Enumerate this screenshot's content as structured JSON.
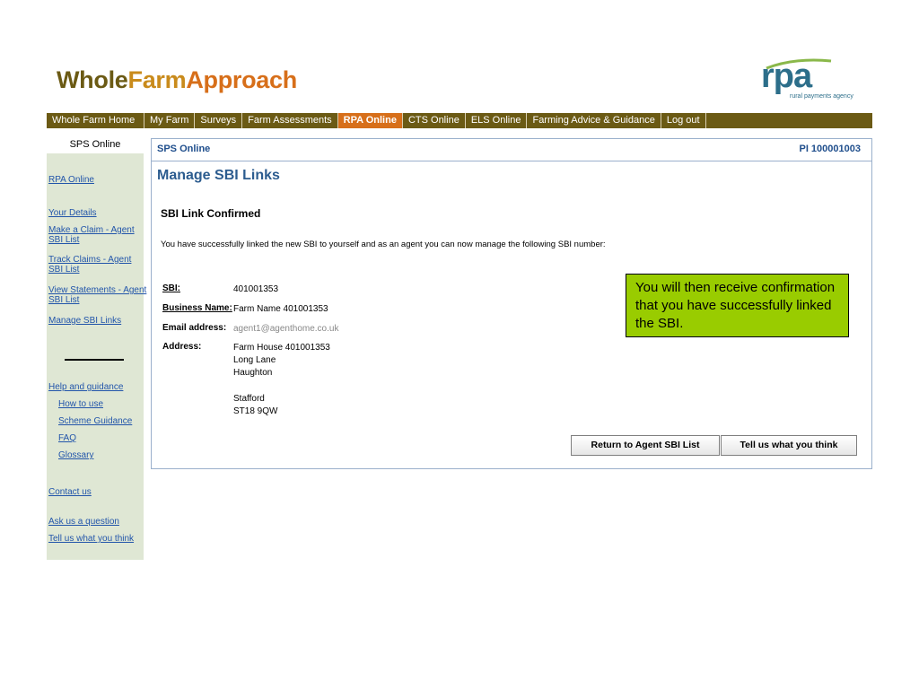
{
  "header": {
    "logo_whole": "Whole",
    "logo_farm": "Farm",
    "logo_approach": "Approach",
    "rpa_logo": "rpa",
    "rpa_tagline": "rural payments agency"
  },
  "nav": {
    "items": [
      "Whole Farm Home",
      "My Farm",
      "Surveys",
      "Farm Assessments",
      "RPA Online",
      "CTS Online",
      "ELS Online",
      "Farming Advice & Guidance",
      "Log out"
    ],
    "active": "RPA Online"
  },
  "sidebar": {
    "tab": "SPS Online",
    "links": {
      "rpa_online": "RPA Online",
      "your_details": "Your Details",
      "make_claim": "Make a Claim - Agent SBI List",
      "track_claims": "Track Claims - Agent SBI List",
      "view_statements": "View Statements - Agent SBI List",
      "manage_sbi": "Manage SBI Links",
      "help": "Help and guidance",
      "how_to_use": "How to use",
      "scheme_guidance": "Scheme Guidance",
      "faq": "FAQ",
      "glossary": "Glossary",
      "contact": "Contact us",
      "ask": "Ask us a question",
      "tell": "Tell us what you think"
    }
  },
  "panel": {
    "header_left": "SPS Online",
    "header_right": "PI 100001003",
    "title": "Manage SBI Links",
    "subtitle": "SBI Link Confirmed",
    "intro": "You have successfully linked the new SBI to yourself and as an agent you can now manage the following SBI number:",
    "details": {
      "sbi_label": "SBI:",
      "sbi_value": "401001353",
      "business_label": "Business Name:",
      "business_value": "Farm Name 401001353",
      "email_label": "Email address:",
      "email_value": "agent1@agenthome.co.uk",
      "address_label": "Address:",
      "address_line1": "Farm House 401001353",
      "address_line2": "Long Lane",
      "address_line3": "Haughton",
      "address_line4": "Stafford",
      "address_line5": "ST18 9QW"
    },
    "buttons": {
      "return": "Return to Agent SBI List",
      "tell": "Tell us what you think"
    }
  },
  "callout": {
    "text": "You will then receive confirmation that you have successfully linked the SBI."
  },
  "colors": {
    "nav_bg": "#6b5a14",
    "nav_active": "#d76f1a",
    "sidebar_bg": "#dfe7d4",
    "callout_bg": "#99cc00",
    "link": "#2255aa",
    "title": "#2c5c8f"
  }
}
